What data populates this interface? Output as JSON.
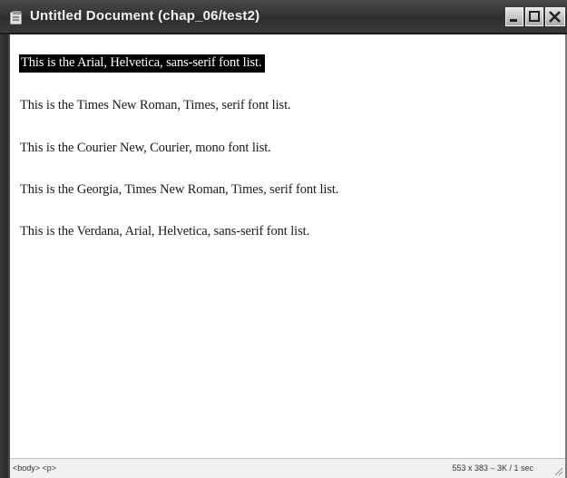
{
  "window": {
    "title": "Untitled Document (chap_06/test2)"
  },
  "content": {
    "lines": [
      "This is the Arial, Helvetica, sans-serif font list.",
      "This is the Times New Roman, Times, serif font list.",
      "This is the Courier New, Courier, mono font list.",
      "This is the Georgia, Times New Roman, Times, serif font list.",
      "This is the Verdana, Arial, Helvetica, sans-serif font list."
    ]
  },
  "statusbar": {
    "tag": "<body> <p>",
    "size": "553 x 383 – 3K / 1 sec"
  },
  "colors": {
    "titlebar": "#3a3a3a",
    "selection": "#000000",
    "background": "#ffffff"
  }
}
